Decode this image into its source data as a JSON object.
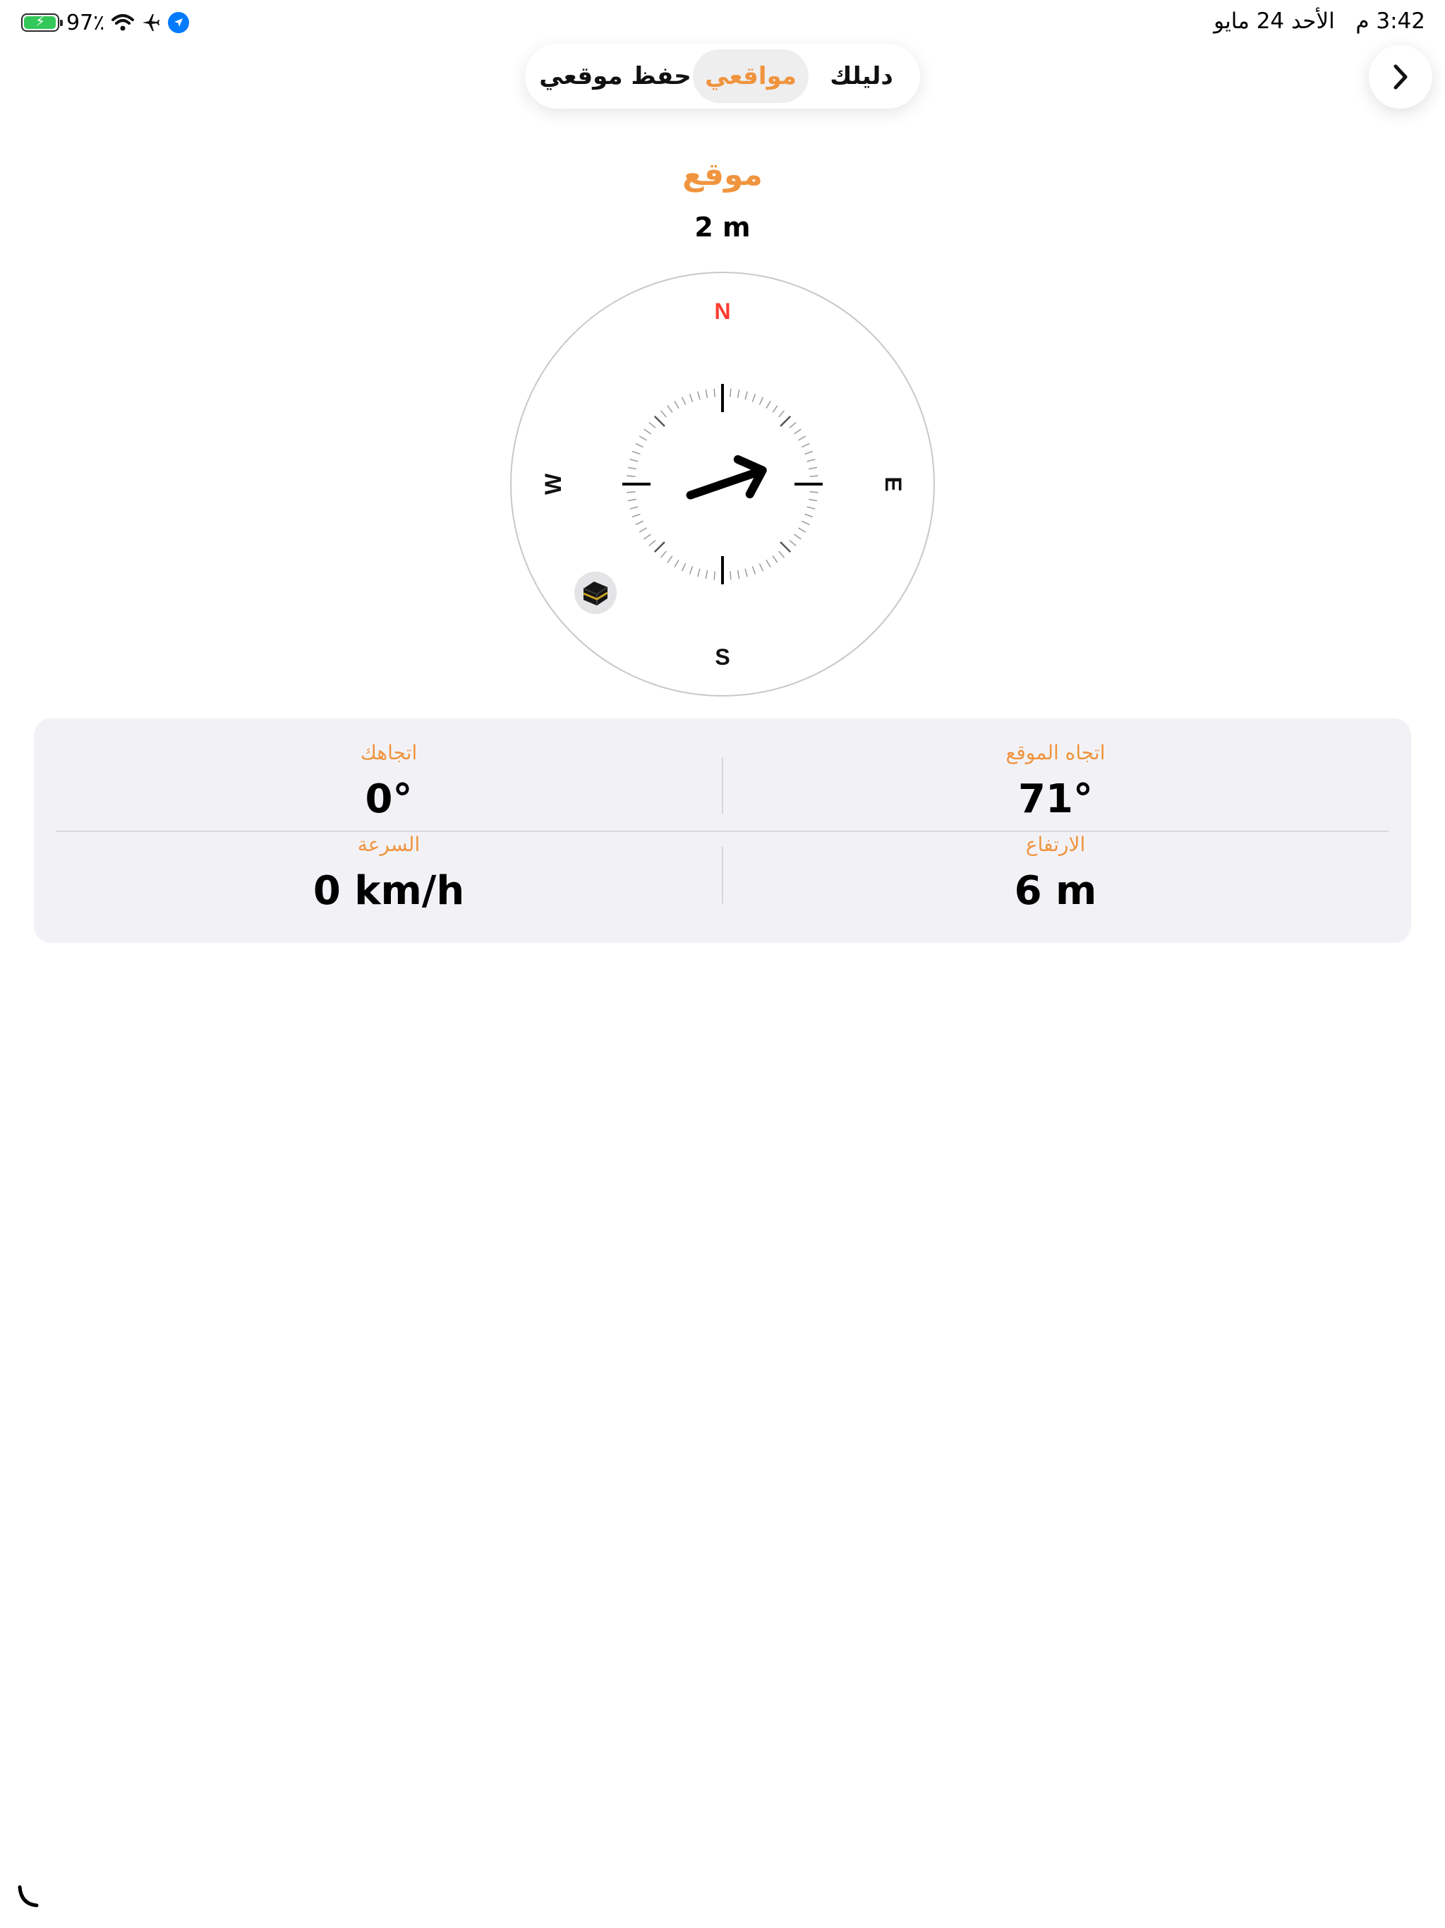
{
  "status_bar": {
    "time": "3:42 م",
    "date": "الأحد 24 مايو",
    "battery_percent": "97٪",
    "battery_level": 0.97,
    "icons": [
      "location-icon",
      "airplane-icon",
      "wifi-icon",
      "battery-charging-icon"
    ]
  },
  "segmented_control": {
    "items": [
      {
        "label": "دليلك",
        "active": false
      },
      {
        "label": "مواقعي",
        "active": true
      },
      {
        "label": "حفظ موقعي",
        "active": false
      }
    ]
  },
  "nav": {
    "forward_icon": "chevron-right-icon"
  },
  "location": {
    "title": "موقع",
    "distance": "2 m"
  },
  "compass": {
    "cardinals": {
      "north": "N",
      "east": "E",
      "south": "S",
      "west": "W"
    },
    "north_color": "#ff3b30",
    "heading_deg": 0,
    "arrow_bearing_deg": 71,
    "kaaba_icon": "kaaba-icon"
  },
  "info": {
    "site_direction": {
      "label": "اتجاه الموقع",
      "value": "71°"
    },
    "your_direction": {
      "label": "اتجاهك",
      "value": "0°"
    },
    "altitude": {
      "label": "الارتفاع",
      "value": "6 m"
    },
    "speed": {
      "label": "السرعة",
      "value": "0 km/h"
    }
  },
  "colors": {
    "accent": "#f0943e",
    "card_background": "#f2f2f6",
    "north": "#ff3b30"
  }
}
